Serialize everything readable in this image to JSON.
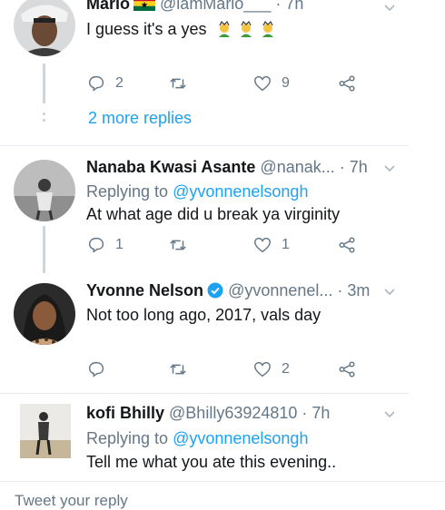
{
  "tweets": [
    {
      "name": "Mario",
      "handle": "@iamMario___",
      "time": "· 7h",
      "text": "I guess it's a yes",
      "reply_count": "2",
      "retweet_count": "",
      "like_count": "9",
      "more_replies": "2 more replies"
    },
    {
      "name": "Nanaba Kwasi Asante",
      "handle": "@nanak...",
      "time": "· 7h",
      "replying_prefix": "Replying to",
      "replying_to": "@yvonnenelsongh",
      "text": "At what age did u break ya virginity",
      "reply_count": "1",
      "retweet_count": "",
      "like_count": "1"
    },
    {
      "name": "Yvonne Nelson",
      "handle": "@yvonnenel...",
      "time": "· 3m",
      "text": "Not too long ago, 2017, vals day",
      "reply_count": "",
      "retweet_count": "",
      "like_count": "2"
    },
    {
      "name": "kofi Bhilly",
      "handle": "@Bhilly63924810",
      "time": "· 7h",
      "replying_prefix": "Replying to",
      "replying_to": "@yvonnenelsongh",
      "text": "Tell me what you ate this evening.."
    }
  ],
  "composer": {
    "placeholder": "Tweet your reply"
  },
  "colors": {
    "accent": "#1da1f2",
    "muted": "#657786",
    "text": "#14171a",
    "line": "#ccd6dd"
  },
  "icons": [
    "reply-icon",
    "retweet-icon",
    "like-icon",
    "share-icon",
    "chevron-down-icon",
    "verified-icon",
    "ghana-flag-icon"
  ]
}
